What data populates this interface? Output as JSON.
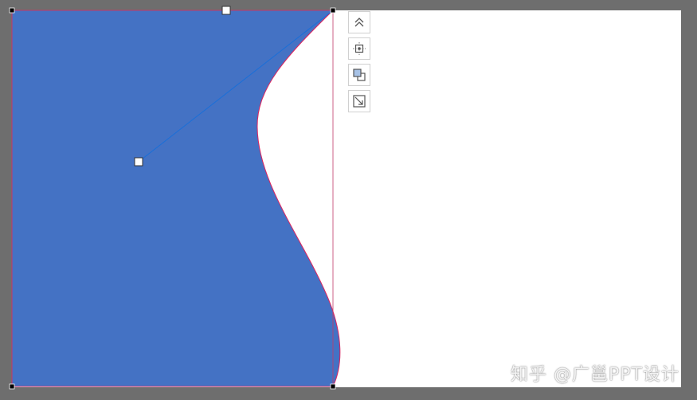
{
  "colors": {
    "background": "#6e6e6e",
    "slide": "#ffffff",
    "shape_fill": "#4472c4",
    "shape_outline": "#e0245e",
    "rotation_line": "#1a6fd8",
    "handle_fill": "#ffffff",
    "vertex_fill": "#000000"
  },
  "toolbar": {
    "items": [
      {
        "name": "layout-options",
        "icon": "double-chevron-up-icon"
      },
      {
        "name": "align-center",
        "icon": "align-center-icon"
      },
      {
        "name": "arrange-order",
        "icon": "bring-forward-icon"
      },
      {
        "name": "resize-shape",
        "icon": "resize-diagonal-icon"
      }
    ]
  },
  "watermark": {
    "text": "知乎 @广邕PPT设计"
  }
}
